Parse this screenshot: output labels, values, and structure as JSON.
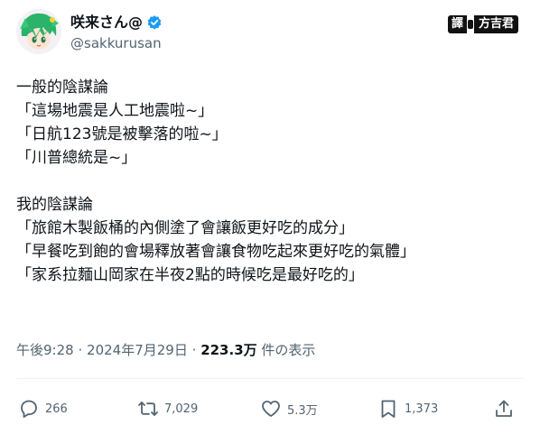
{
  "author": {
    "display_name": "咲来さん@",
    "handle": "@sakkurusan"
  },
  "translator_badge": {
    "left_label": "譯",
    "right_label": "方吉君"
  },
  "tweet": {
    "lines": [
      "一般的陰謀論",
      "「這場地震是人工地震啦~」",
      "「日航123號是被擊落的啦~」",
      "「川普總統是~」",
      "",
      "我的陰謀論",
      "「旅館木製飯桶的內側塗了會讓飯更好吃的成分」",
      "「早餐吃到飽的會場釋放著會讓食物吃起來更好吃的氣體」",
      "「家系拉麵山岡家在半夜2點的時候吃是最好吃的」"
    ]
  },
  "meta": {
    "time": "午後9:28",
    "date": "2024年7月29日",
    "separator": "·",
    "views_count": "223.3万",
    "views_label": "件の表示"
  },
  "actions": {
    "reply_count": "266",
    "retweet_count": "7,029",
    "like_count": "5.3万",
    "bookmark_count": "1,373"
  },
  "colors": {
    "text": "#0f1419",
    "secondary": "#536471",
    "verified": "#1d9bf0",
    "divider": "#eff3f4"
  }
}
